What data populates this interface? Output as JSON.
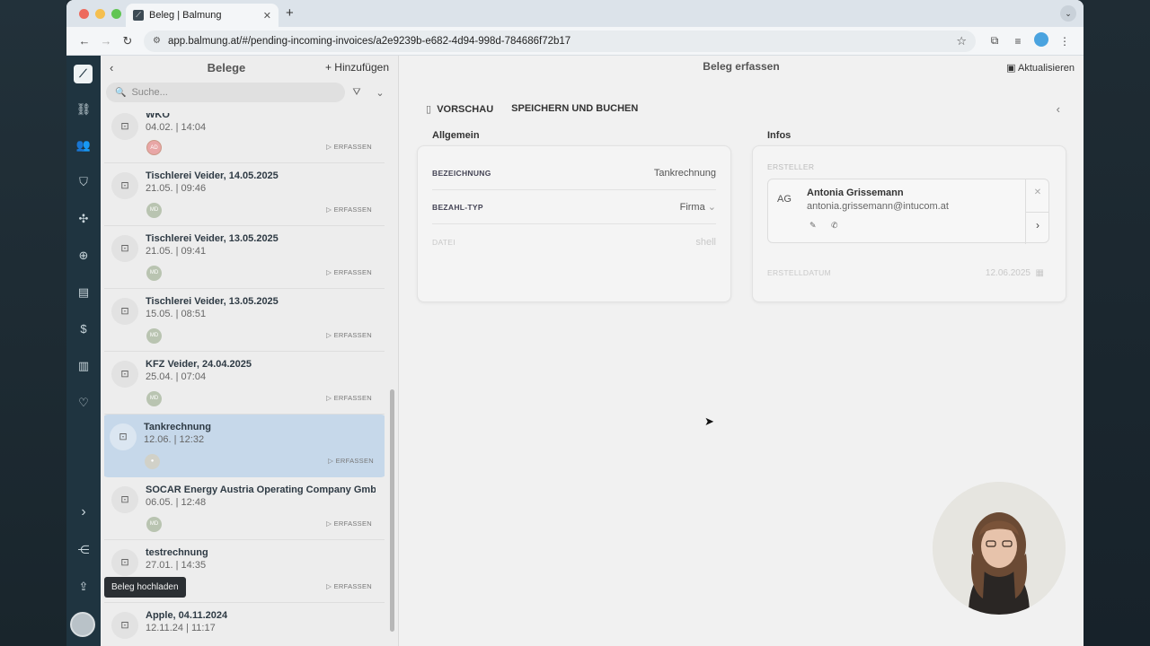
{
  "browser": {
    "tab_title": "Beleg | Balmung",
    "url": "app.balmung.at/#/pending-incoming-invoices/a2e9239b-e682-4d94-998d-784686f72b17",
    "newtab": "+"
  },
  "rail": {
    "tooltip": "Beleg hochladen"
  },
  "list": {
    "title": "Belege",
    "add_label": "Hinzufügen",
    "search_placeholder": "Suche...",
    "action_label": "ERFASSEN",
    "entries": [
      {
        "title": "WKO",
        "sub": "04.02. | 14:04",
        "avatar": "AD"
      },
      {
        "title": "Tischlerei Veider, 14.05.2025",
        "sub": "21.05. | 09:46",
        "avatar": "MD"
      },
      {
        "title": "Tischlerei Veider, 13.05.2025",
        "sub": "21.05. | 09:41",
        "avatar": "MD"
      },
      {
        "title": "Tischlerei Veider, 13.05.2025",
        "sub": "15.05. | 08:51",
        "avatar": "MD"
      },
      {
        "title": "KFZ Veider, 24.04.2025",
        "sub": "25.04. | 07:04",
        "avatar": "MD"
      },
      {
        "title": "Tankrechnung",
        "sub": "12.06. | 12:32",
        "avatar": ""
      },
      {
        "title": "SOCAR Energy Austria Operating Company Gmb...",
        "sub": "06.05. | 12:48",
        "avatar": "MD"
      },
      {
        "title": "testrechnung",
        "sub": "27.01. | 14:35",
        "avatar": ""
      },
      {
        "title": "Apple, 04.11.2024",
        "sub": "12.11.24 | 11:17",
        "avatar": ""
      }
    ]
  },
  "main": {
    "title": "Beleg erfassen",
    "refresh_label": "Aktualisieren",
    "preview_label": "VORSCHAU",
    "save_label": "SPEICHERN UND BUCHEN",
    "general": {
      "title": "Allgemein",
      "fields": [
        {
          "label": "BEZEICHNUNG",
          "value": "Tankrechnung"
        },
        {
          "label": "BEZAHL-TYP",
          "value": "Firma"
        },
        {
          "label": "DATEI",
          "value": "shell"
        }
      ]
    },
    "infos": {
      "title": "Infos",
      "creator_label": "ERSTELLER",
      "creator_initials": "AG",
      "creator_name": "Antonia Grissemann",
      "creator_email": "antonia.grissemann@intucom.at",
      "date_label": "ERSTELLDATUM",
      "date_value": "12.06.2025"
    }
  }
}
